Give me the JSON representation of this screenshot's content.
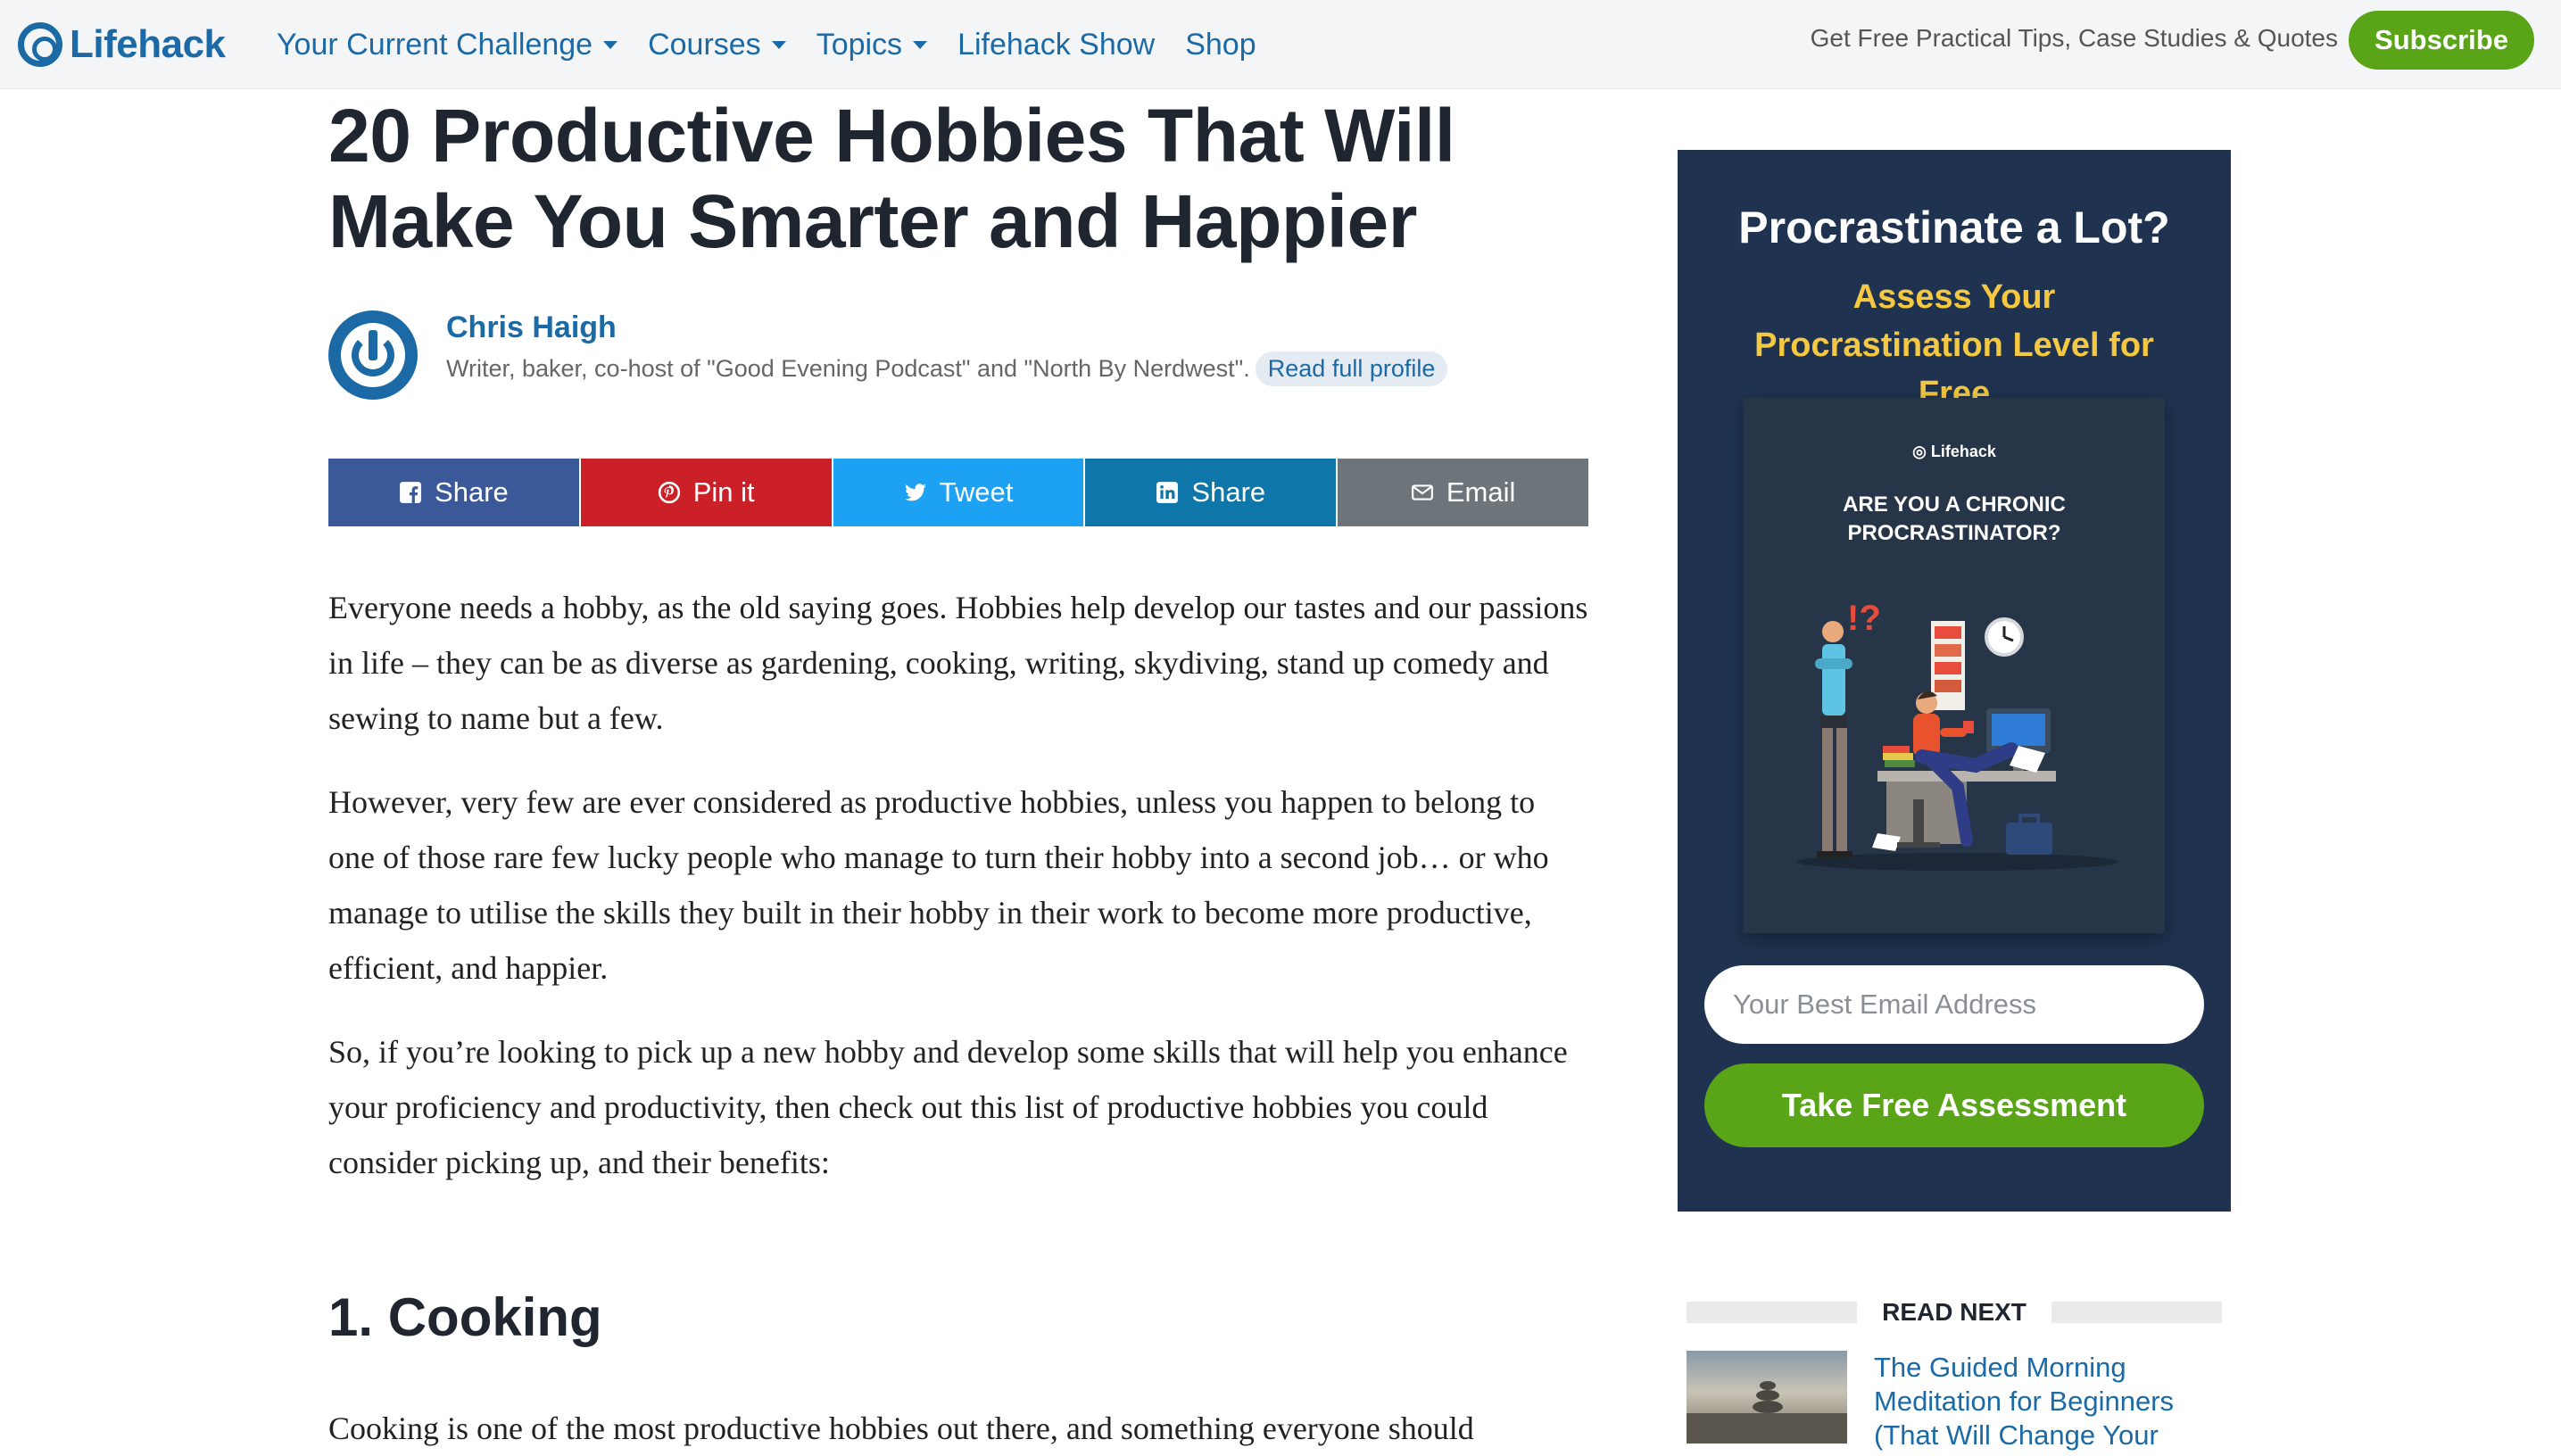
{
  "brand": {
    "logo_text": "Lifehack",
    "accent": "#1b6aa5",
    "green": "#5aa417"
  },
  "nav": {
    "items": [
      {
        "label": "Your Current Challenge",
        "has_dropdown": true
      },
      {
        "label": "Courses",
        "has_dropdown": true
      },
      {
        "label": "Topics",
        "has_dropdown": true
      },
      {
        "label": "Lifehack Show",
        "has_dropdown": false
      },
      {
        "label": "Shop",
        "has_dropdown": false
      }
    ],
    "tagline": "Get Free Practical Tips, Case Studies & Quotes",
    "subscribe_label": "Subscribe"
  },
  "article": {
    "title": "20 Productive Hobbies That Will Make You Smarter and Happier",
    "author": {
      "name": "Chris Haigh",
      "bio": "Writer, baker, co-host of \"Good Evening Podcast\" and \"North By Nerdwest\".",
      "profile_link": "Read full profile"
    },
    "share_buttons": [
      {
        "label": "Share",
        "icon": "facebook-icon",
        "color": "#3b5998"
      },
      {
        "label": "Pin it",
        "icon": "pinterest-icon",
        "color": "#cb2027"
      },
      {
        "label": "Tweet",
        "icon": "twitter-icon",
        "color": "#1da1f2"
      },
      {
        "label": "Share",
        "icon": "linkedin-icon",
        "color": "#0e76a8"
      },
      {
        "label": "Email",
        "icon": "email-icon",
        "color": "#6d747a"
      }
    ],
    "paragraphs": [
      "Everyone needs a hobby, as the old saying goes. Hobbies help develop our tastes and our passions in life – they can be as diverse as gardening, cooking, writing, skydiving, stand up comedy and sewing to name but a few.",
      "However, very few are ever considered as productive hobbies, unless you happen to belong to one of those rare few lucky people who manage to turn their hobby into a second job… or who manage to utilise the skills they built in their hobby in their work to become more productive, efficient, and happier.",
      "So, if you’re looking to pick up a new hobby and develop some skills that will help you enhance your proficiency and productivity, then check out this list of productive hobbies you could consider picking up, and their benefits:"
    ],
    "section_heading": "1. Cooking",
    "section_paragraph": "Cooking is one of the most productive hobbies out there, and something everyone should"
  },
  "sidebar": {
    "ad": {
      "title": "Procrastinate a Lot?",
      "subtitle": "Assess Your Procrastination Level for Free",
      "book_brand": "Lifehack",
      "book_title": "ARE YOU A CHRONIC PROCRASTINATOR?",
      "email_placeholder": "Your Best Email Address",
      "email_value": "",
      "cta_label": "Take Free Assessment"
    },
    "read_next": {
      "label": "READ NEXT",
      "items": [
        {
          "title": "The Guided Morning Meditation for Beginners (That Will Change Your"
        }
      ]
    }
  }
}
